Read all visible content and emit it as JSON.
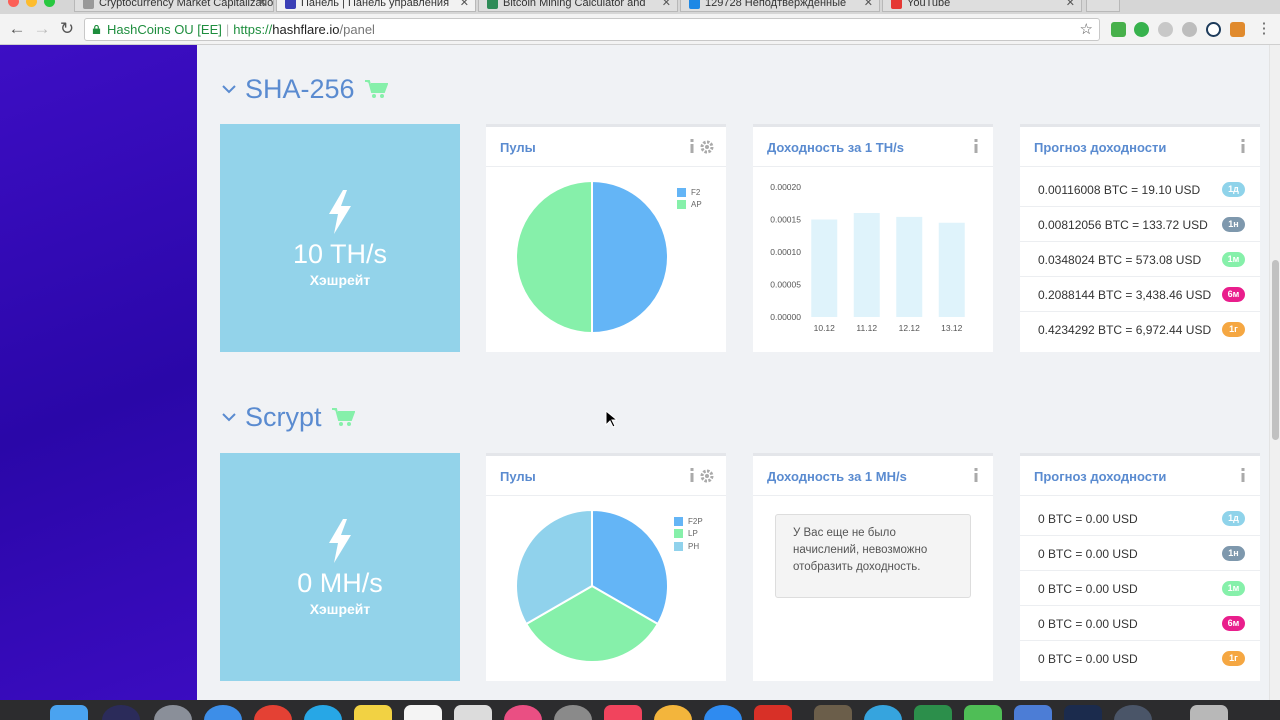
{
  "browser": {
    "tabs": [
      {
        "title": "Cryptocurrency Market Capitalizations",
        "favicon_color": "#888888"
      },
      {
        "title": "Панель | Панель управления",
        "favicon_color": "#3b3fb6"
      },
      {
        "title": "Bitcoin Mining Calculator and",
        "favicon_color": "#2e8b57"
      },
      {
        "title": "129728 Неподтвержденные",
        "favicon_color": "#1e88e5"
      },
      {
        "title": "YouTube",
        "favicon_color": "#e53935"
      }
    ],
    "address": {
      "secure_label": "HashCoins OU [EE]",
      "scheme": "https://",
      "host": "hashflare.io",
      "path": "/panel"
    }
  },
  "sections": [
    {
      "title": "SHA-256",
      "hashrate_value": "10 TH/s",
      "hashrate_label": "Хэшрейт",
      "pools_title": "Пулы",
      "pools_chart": {
        "type": "pie",
        "slices": [
          {
            "name": "F2",
            "value": 50,
            "color": "#64b5f6"
          },
          {
            "name": "AP",
            "value": 50,
            "color": "#86f0aa"
          }
        ]
      },
      "profit_title": "Доходность за 1 TH/s",
      "profit_chart": {
        "type": "bar",
        "categories": [
          "10.12",
          "11.12",
          "12.12",
          "13.12"
        ],
        "values": [
          0.00015,
          0.00016,
          0.000154,
          0.000145
        ],
        "yticks": [
          "0.00000",
          "0.00005",
          "0.00010",
          "0.00015",
          "0.00020"
        ],
        "ylim": [
          0,
          0.0002
        ],
        "bar_color": "#dff3fb"
      },
      "forecast_title": "Прогноз доходности",
      "forecast": [
        {
          "text": "0.00116008 BTC = 19.10 USD",
          "badge": "1д",
          "color": "#8fd3ea"
        },
        {
          "text": "0.00812056 BTC = 133.72 USD",
          "badge": "1н",
          "color": "#7e98ad"
        },
        {
          "text": "0.0348024 BTC = 573.08 USD",
          "badge": "1м",
          "color": "#86f0aa"
        },
        {
          "text": "0.2088144 BTC = 3,438.46 USD",
          "badge": "6м",
          "color": "#e91e8c"
        },
        {
          "text": "0.4234292 BTC = 6,972.44 USD",
          "badge": "1г",
          "color": "#f5a742"
        }
      ]
    },
    {
      "title": "Scrypt",
      "hashrate_value": "0 MH/s",
      "hashrate_label": "Хэшрейт",
      "pools_title": "Пулы",
      "pools_chart": {
        "type": "pie",
        "slices": [
          {
            "name": "F2P",
            "value": 33.33,
            "color": "#64b5f6"
          },
          {
            "name": "LP",
            "value": 33.33,
            "color": "#86f0aa"
          },
          {
            "name": "PH",
            "value": 33.34,
            "color": "#90d2ec"
          }
        ]
      },
      "profit_title": "Доходность за 1 MH/s",
      "no_data_text": "У Вас еще не было начислений, невозможно отобразить доходность.",
      "forecast_title": "Прогноз доходности",
      "forecast": [
        {
          "text": "0 BTC = 0.00 USD",
          "badge": "1д",
          "color": "#8fd3ea"
        },
        {
          "text": "0 BTC = 0.00 USD",
          "badge": "1н",
          "color": "#7e98ad"
        },
        {
          "text": "0 BTC = 0.00 USD",
          "badge": "1м",
          "color": "#86f0aa"
        },
        {
          "text": "0 BTC = 0.00 USD",
          "badge": "6м",
          "color": "#e91e8c"
        },
        {
          "text": "0 BTC = 0.00 USD",
          "badge": "1г",
          "color": "#f5a742"
        }
      ]
    }
  ]
}
